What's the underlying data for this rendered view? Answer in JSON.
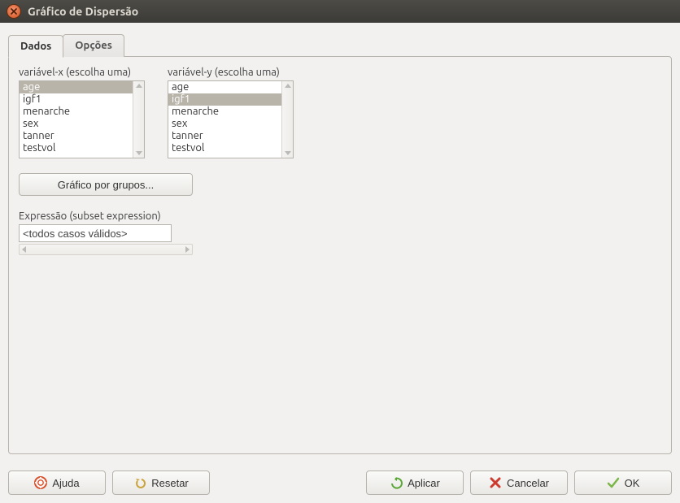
{
  "window": {
    "title": "Gráfico de Dispersão"
  },
  "tabs": {
    "data": "Dados",
    "options": "Opções",
    "active": "data"
  },
  "panel": {
    "xvar": {
      "label": "variável-x (escolha uma)",
      "items": [
        "age",
        "igf1",
        "menarche",
        "sex",
        "tanner",
        "testvol"
      ],
      "selected": "age"
    },
    "yvar": {
      "label": "variável-y (escolha uma)",
      "items": [
        "age",
        "igf1",
        "menarche",
        "sex",
        "tanner",
        "testvol"
      ],
      "selected": "igf1"
    },
    "groups_button": "Gráfico por grupos...",
    "expression": {
      "label": "Expressão (subset expression)",
      "value": "<todos casos válidos>"
    }
  },
  "buttons": {
    "help": "Ajuda",
    "reset": "Resetar",
    "apply": "Aplicar",
    "cancel": "Cancelar",
    "ok": "OK"
  }
}
